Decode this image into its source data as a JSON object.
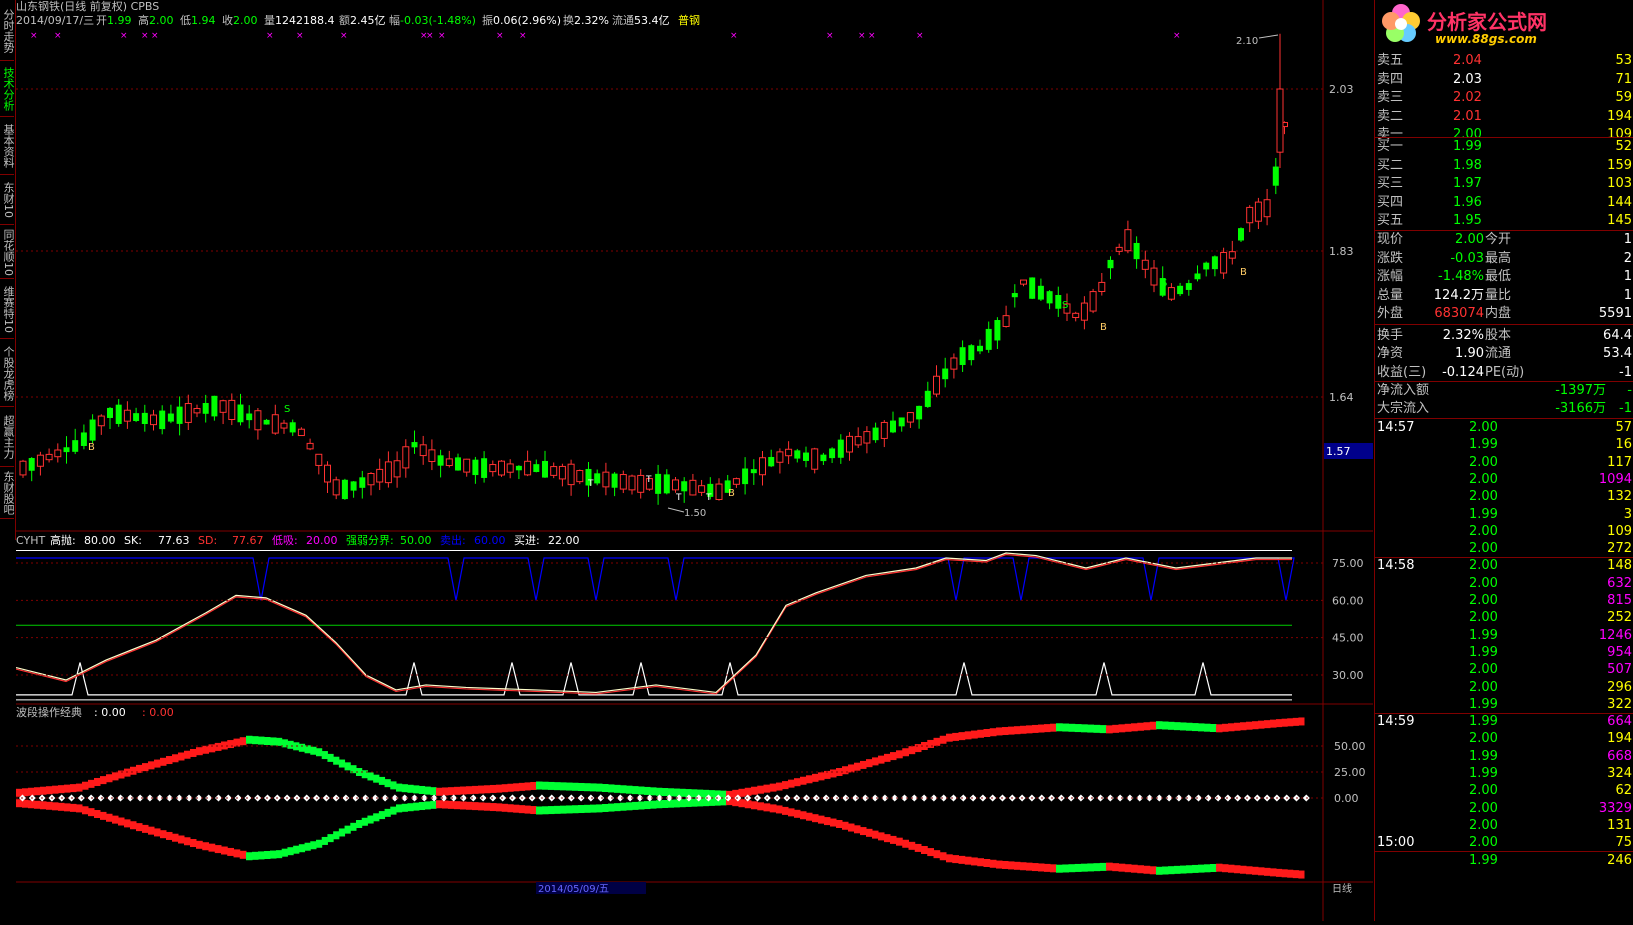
{
  "nav_tabs": [
    {
      "label": "分时走势",
      "active": false
    },
    {
      "label": "技术分析",
      "active": true
    },
    {
      "label": "基本资料",
      "active": false
    },
    {
      "label": "东财10",
      "active": false
    },
    {
      "label": "同花顺10",
      "active": false
    },
    {
      "label": "维赛特10",
      "active": false
    },
    {
      "label": "个股龙虎榜",
      "active": false
    },
    {
      "label": "超赢主力",
      "active": false
    },
    {
      "label": "东财股吧",
      "active": false
    }
  ],
  "header": {
    "title": "山东钢铁(日线 前复权) CPBS",
    "date": "2014/09/17/三",
    "open_label": "开",
    "open": "1.99",
    "high_label": "高",
    "high": "2.00",
    "low_label": "低",
    "low": "1.94",
    "close_label": "收",
    "close": "2.00",
    "vol_label": "量",
    "vol": "1242188.4",
    "amt_label": "额",
    "amt": "2.45亿",
    "chg_label": "幅",
    "chg": "-0.03(-1.48%)",
    "amp_label": "振",
    "amp": "0.06(2.96%)",
    "turn_label": "换",
    "turn": "2.32%",
    "float_label": "流通",
    "float": "53.4亿",
    "sector": "普钢"
  },
  "price_axis": {
    "labels": [
      "2.03",
      "1.83",
      "1.64"
    ],
    "current_tag": "1.57"
  },
  "price_annotations": {
    "high_mark": "2.10",
    "low_mark": "1.50"
  },
  "signal_markers": {
    "buy": "B",
    "sell": "S",
    "t": "T"
  },
  "cyht": {
    "name": "CYHT",
    "items": [
      {
        "label": "高抛:",
        "value": "80.00",
        "color": "#ffffff"
      },
      {
        "label": "SK:",
        "value": "77.63",
        "color": "#ffffff"
      },
      {
        "label": "SD:",
        "value": "77.67",
        "color": "#ff3232"
      },
      {
        "label": "低吸:",
        "value": "20.00",
        "color": "#ff00ff"
      },
      {
        "label": "强弱分界:",
        "value": "50.00",
        "color": "#00ff00"
      },
      {
        "label": "卖出:",
        "value": "60.00",
        "color": "#0000ff"
      },
      {
        "label": "买进:",
        "value": "22.00",
        "color": "#ffffff"
      }
    ],
    "axis_labels": [
      "75.00",
      "60.00",
      "45.00",
      "30.00"
    ]
  },
  "wave": {
    "name": "波段操作经典",
    "value1": ": 0.00",
    "value2": ": 0.00",
    "axis_labels": [
      "50.00",
      "25.00",
      "0.00"
    ]
  },
  "bottom_axis": {
    "date_label": "2014/05/09/五",
    "right_label": "日线"
  },
  "logo": {
    "text": "分析家公式网",
    "url": "www.88gs.com"
  },
  "orderbook": {
    "asks": [
      {
        "label": "卖五",
        "price": "2.04",
        "vol": "53"
      },
      {
        "label": "卖四",
        "price": "2.03",
        "vol": "71"
      },
      {
        "label": "卖三",
        "price": "2.02",
        "vol": "59"
      },
      {
        "label": "卖二",
        "price": "2.01",
        "vol": "194"
      },
      {
        "label": "卖一",
        "price": "2.00",
        "vol": "109"
      }
    ],
    "bids": [
      {
        "label": "买一",
        "price": "1.99",
        "vol": "52"
      },
      {
        "label": "买二",
        "price": "1.98",
        "vol": "159"
      },
      {
        "label": "买三",
        "price": "1.97",
        "vol": "103"
      },
      {
        "label": "买四",
        "price": "1.96",
        "vol": "144"
      },
      {
        "label": "买五",
        "price": "1.95",
        "vol": "145"
      }
    ]
  },
  "quote": [
    {
      "l1": "现价",
      "v1": "2.00",
      "c1": "#00ff00",
      "l2": "今开",
      "v2": "1"
    },
    {
      "l1": "涨跌",
      "v1": "-0.03",
      "c1": "#00ff00",
      "l2": "最高",
      "v2": "2"
    },
    {
      "l1": "涨幅",
      "v1": "-1.48%",
      "c1": "#00ff00",
      "l2": "最低",
      "v2": "1"
    },
    {
      "l1": "总量",
      "v1": "124.2万",
      "c1": "#ffffff",
      "l2": "量比",
      "v2": "1"
    },
    {
      "l1": "外盘",
      "v1": "683074",
      "c1": "#ff3232",
      "l2": "内盘",
      "v2": "5591"
    },
    {
      "l1": "换手",
      "v1": "2.32%",
      "c1": "#ffffff",
      "l2": "股本",
      "v2": "64.4"
    },
    {
      "l1": "净资",
      "v1": "1.90",
      "c1": "#ffffff",
      "l2": "流通",
      "v2": "53.4"
    },
    {
      "l1": "收益(三)",
      "v1": "-0.124",
      "c1": "#ffffff",
      "l2": "PE(动)",
      "v2": "-1"
    }
  ],
  "flow": [
    {
      "label": "净流入额",
      "value": "-1397万",
      "suffix": "-"
    },
    {
      "label": "大宗流入",
      "value": "-3166万",
      "suffix": "-1"
    }
  ],
  "ticks": [
    {
      "time": "14:57",
      "price": "2.00",
      "vol": "57",
      "vc": "#ffff00"
    },
    {
      "time": "",
      "price": "1.99",
      "vol": "16",
      "vc": "#ffff00"
    },
    {
      "time": "",
      "price": "2.00",
      "vol": "117",
      "vc": "#ffff00"
    },
    {
      "time": "",
      "price": "2.00",
      "vol": "1094",
      "vc": "#ff00ff"
    },
    {
      "time": "",
      "price": "2.00",
      "vol": "132",
      "vc": "#ffff00"
    },
    {
      "time": "",
      "price": "1.99",
      "vol": "3",
      "vc": "#ffff00"
    },
    {
      "time": "",
      "price": "2.00",
      "vol": "109",
      "vc": "#ffff00"
    },
    {
      "time": "",
      "price": "2.00",
      "vol": "272",
      "vc": "#ffff00"
    },
    {
      "time": "14:58",
      "price": "2.00",
      "vol": "148",
      "vc": "#ffff00"
    },
    {
      "time": "",
      "price": "2.00",
      "vol": "632",
      "vc": "#ff00ff"
    },
    {
      "time": "",
      "price": "2.00",
      "vol": "815",
      "vc": "#ff00ff"
    },
    {
      "time": "",
      "price": "2.00",
      "vol": "252",
      "vc": "#ffff00"
    },
    {
      "time": "",
      "price": "1.99",
      "vol": "1246",
      "vc": "#ff00ff"
    },
    {
      "time": "",
      "price": "1.99",
      "vol": "954",
      "vc": "#ff00ff"
    },
    {
      "time": "",
      "price": "2.00",
      "vol": "507",
      "vc": "#ff00ff"
    },
    {
      "time": "",
      "price": "2.00",
      "vol": "296",
      "vc": "#ffff00"
    },
    {
      "time": "",
      "price": "1.99",
      "vol": "322",
      "vc": "#ffff00"
    },
    {
      "time": "14:59",
      "price": "1.99",
      "vol": "664",
      "vc": "#ff00ff"
    },
    {
      "time": "",
      "price": "2.00",
      "vol": "194",
      "vc": "#ffff00"
    },
    {
      "time": "",
      "price": "1.99",
      "vol": "668",
      "vc": "#ff00ff"
    },
    {
      "time": "",
      "price": "1.99",
      "vol": "324",
      "vc": "#ffff00"
    },
    {
      "time": "",
      "price": "2.00",
      "vol": "62",
      "vc": "#ffff00"
    },
    {
      "time": "",
      "price": "2.00",
      "vol": "3329",
      "vc": "#ff00ff"
    },
    {
      "time": "",
      "price": "2.00",
      "vol": "131",
      "vc": "#ffff00"
    },
    {
      "time": "15:00",
      "price": "2.00",
      "vol": "75",
      "vc": "#ffff00"
    },
    {
      "time": "",
      "price": "1.99",
      "vol": "246",
      "vc": "#ffff00"
    }
  ]
}
